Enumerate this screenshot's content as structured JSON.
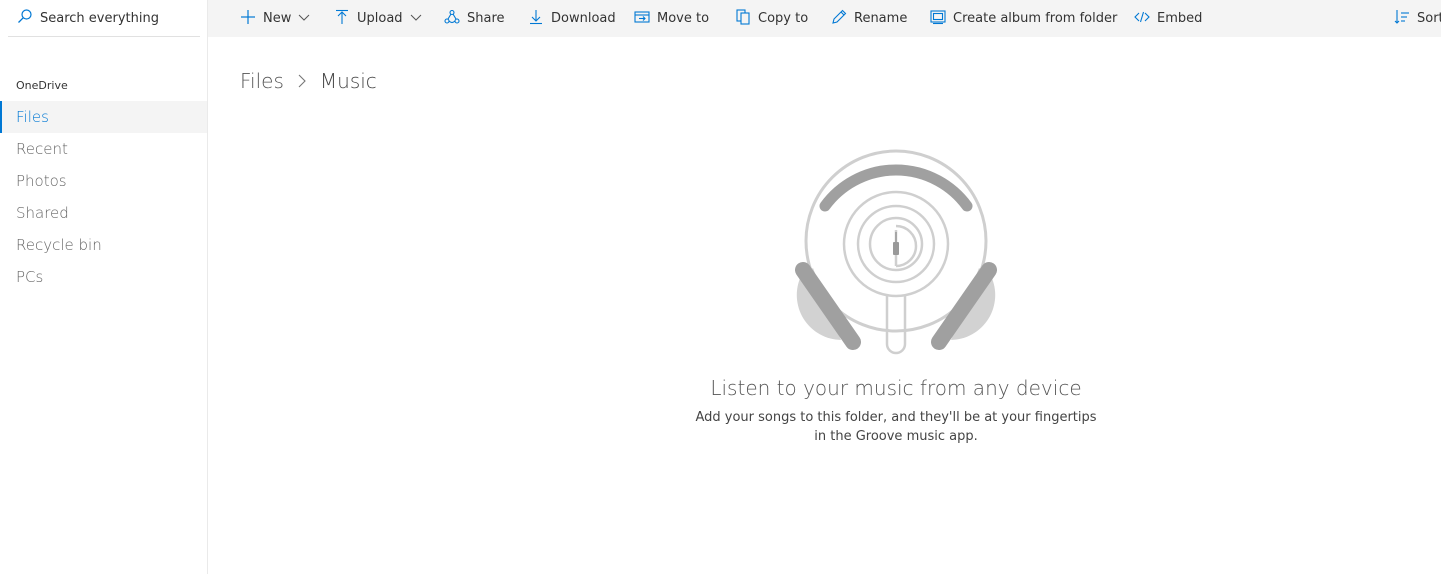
{
  "search": {
    "label": "Search everything",
    "icon": "search-icon"
  },
  "sidebar": {
    "section_label": "OneDrive",
    "accent_color": "#0078d4",
    "items": [
      {
        "label": "Files",
        "active": true
      },
      {
        "label": "Recent"
      },
      {
        "label": "Photos"
      },
      {
        "label": "Shared"
      },
      {
        "label": "Recycle bin"
      },
      {
        "label": "PCs"
      }
    ]
  },
  "commands": {
    "new": {
      "label": "New",
      "icon": "plus-icon"
    },
    "upload": {
      "label": "Upload",
      "icon": "upload-icon"
    },
    "share": {
      "label": "Share",
      "icon": "share-icon"
    },
    "download": {
      "label": "Download",
      "icon": "download-icon"
    },
    "move_to": {
      "label": "Move to",
      "icon": "move-to-icon"
    },
    "copy_to": {
      "label": "Copy to",
      "icon": "copy-icon"
    },
    "rename": {
      "label": "Rename",
      "icon": "pencil-icon"
    },
    "create_album": {
      "label": "Create album from folder",
      "icon": "album-icon"
    },
    "embed": {
      "label": "Embed",
      "icon": "embed-icon"
    },
    "sort": {
      "label": "Sort",
      "icon": "sort-icon"
    }
  },
  "breadcrumb": {
    "items": [
      "Files",
      "Music"
    ]
  },
  "empty_state": {
    "illustration": "headphones-illustration",
    "title": "Listen to your music from any device",
    "description": "Add your songs to this folder, and they'll be at your fingertips in the Groove music app."
  }
}
